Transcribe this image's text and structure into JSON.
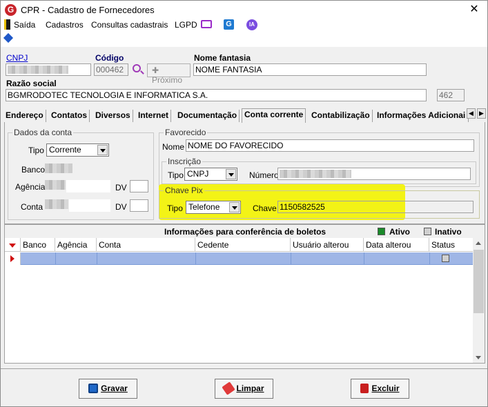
{
  "window": {
    "title": "CPR - Cadastro de Fornecedores",
    "app_icon_letter": "G",
    "close": "✕"
  },
  "menu": {
    "items": [
      "Saída",
      "Cadastros",
      "Consultas cadastrais",
      "LGPD"
    ],
    "ia_badge": "IA"
  },
  "header": {
    "cnpj_label": "CNPJ",
    "codigo_label": "Código",
    "codigo_value": "000462",
    "proximo_label": "Próximo",
    "nome_fantasia_label": "Nome fantasia",
    "nome_fantasia_value": "NOME FANTASIA",
    "razao_social_label": "Razão social",
    "razao_social_value": "BGMRODOTEC TECNOLOGIA E INFORMATICA S.A.",
    "razao_side_value": "462"
  },
  "tabs": [
    "Endereço",
    "Contatos",
    "Diversos",
    "Internet",
    "Documentação",
    "Conta corrente",
    "Contabilização",
    "Informações Adicionai"
  ],
  "active_tab": "Conta corrente",
  "dados_conta": {
    "legend": "Dados da conta",
    "tipo_label": "Tipo",
    "tipo_value": "Corrente",
    "banco_label": "Banco",
    "agencia_label": "Agência",
    "conta_label": "Conta",
    "dv_label": "DV"
  },
  "favorecido": {
    "legend": "Favorecido",
    "nome_label": "Nome",
    "nome_value": "NOME DO FAVORECIDO",
    "inscricao_legend": "Inscrição",
    "tipo_label": "Tipo",
    "tipo_value": "CNPJ",
    "numero_label": "Número"
  },
  "chave_pix": {
    "legend": "Chave Pix",
    "tipo_label": "Tipo",
    "tipo_value": "Telefone",
    "chave_label": "Chave",
    "chave_value": "1150582525"
  },
  "grid": {
    "title": "Informações para conferência de boletos",
    "legend_ativo": "Ativo",
    "legend_inativo": "Inativo",
    "ativo_color": "#1a8a2a",
    "columns": [
      "Banco",
      "Agência",
      "Conta",
      "Cedente",
      "Usuário alterou",
      "Data alterou",
      "Status"
    ]
  },
  "buttons": {
    "gravar": "Gravar",
    "limpar": "Limpar",
    "excluir": "Excluir"
  },
  "colors": {
    "highlight": "#f2f20a",
    "selected_row": "#9fb6e6",
    "brand_red": "#c8242b"
  }
}
